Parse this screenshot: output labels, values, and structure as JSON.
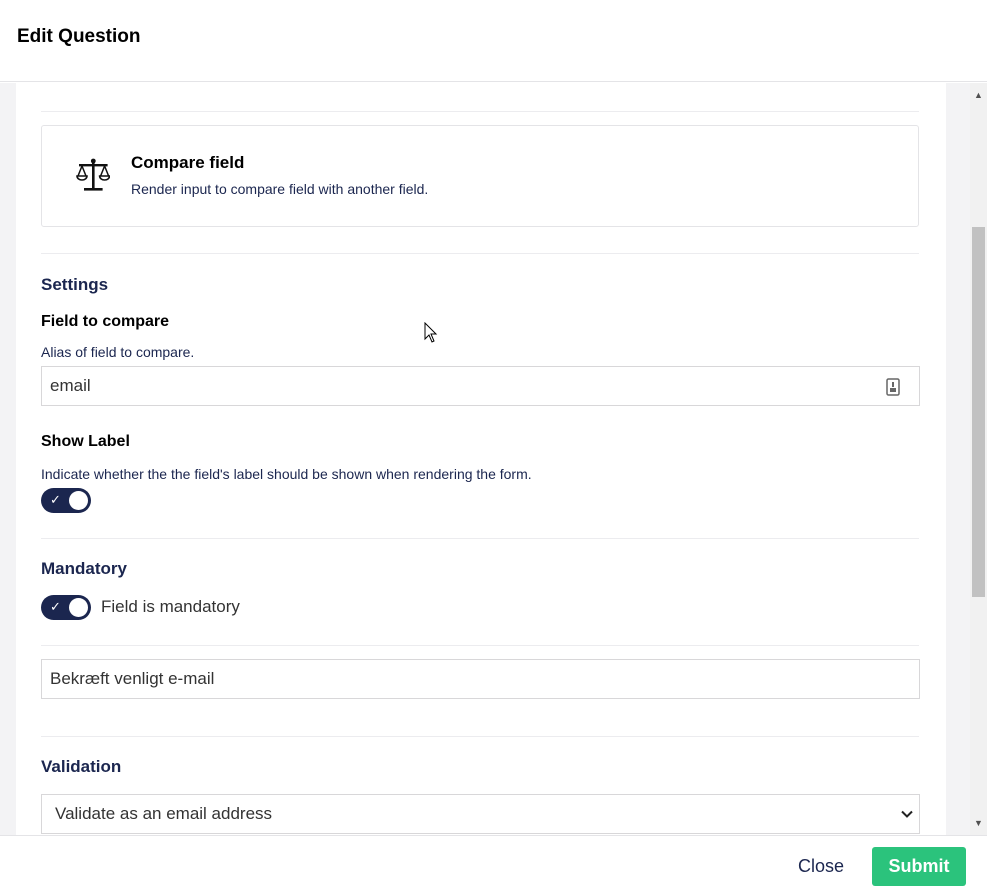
{
  "header": {
    "title": "Edit Question"
  },
  "field_type": {
    "icon": "scale-icon",
    "title": "Compare field",
    "description": "Render input to compare field with another field."
  },
  "settings": {
    "heading": "Settings",
    "field_to_compare": {
      "label": "Field to compare",
      "description": "Alias of field to compare.",
      "value": "email",
      "icon": "field-picker-icon"
    },
    "show_label": {
      "label": "Show Label",
      "description": "Indicate whether the the field's label should be shown when rendering the form.",
      "checked": true
    },
    "mandatory": {
      "label": "Mandatory",
      "toggle_label": "Field is mandatory",
      "checked": true,
      "message_value": "Bekræft venligt e-mail"
    },
    "validation": {
      "label": "Validation",
      "selected": "Validate as an email address"
    }
  },
  "footer": {
    "close_label": "Close",
    "submit_label": "Submit"
  },
  "colors": {
    "primary": "#1b264f",
    "submit": "#2bc37c",
    "border": "#d8d7d9"
  }
}
